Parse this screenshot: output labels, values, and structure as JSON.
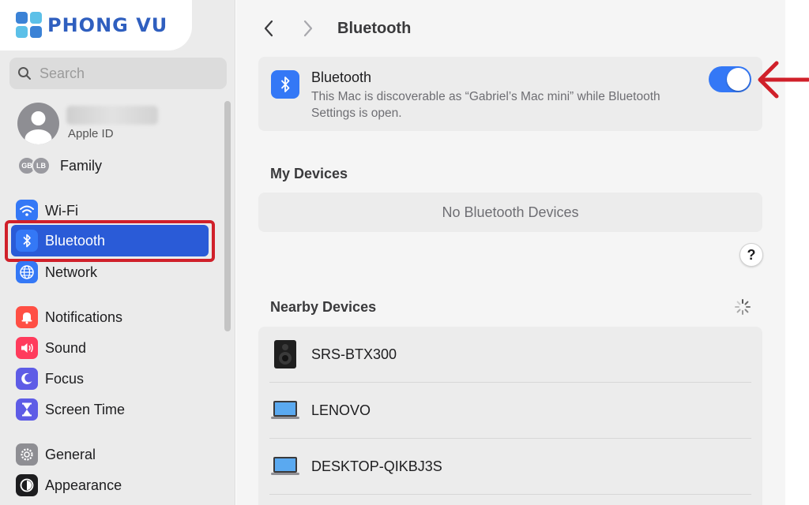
{
  "brand": {
    "name": "PHONG VU"
  },
  "sidebar": {
    "search_placeholder": "Search",
    "apple_id_label": "Apple ID",
    "family": {
      "label": "Family",
      "avatars": [
        "GB",
        "LB"
      ]
    },
    "items": [
      {
        "label": "Wi-Fi",
        "icon": "wifi-icon",
        "color": "#3478f6"
      },
      {
        "label": "Bluetooth",
        "icon": "bluetooth-icon",
        "color": "#3478f6",
        "selected": true
      },
      {
        "label": "Network",
        "icon": "globe-icon",
        "color": "#3478f6"
      },
      {
        "label": "Notifications",
        "icon": "bell-icon",
        "color": "#ff4f44"
      },
      {
        "label": "Sound",
        "icon": "speaker-icon",
        "color": "#ff3b5c"
      },
      {
        "label": "Focus",
        "icon": "moon-icon",
        "color": "#5e5ce6"
      },
      {
        "label": "Screen Time",
        "icon": "hourglass-icon",
        "color": "#5e5ce6"
      },
      {
        "label": "General",
        "icon": "gear-icon",
        "color": "#8e8e93"
      },
      {
        "label": "Appearance",
        "icon": "appearance-icon",
        "color": "#1d1d1f"
      }
    ]
  },
  "main": {
    "title": "Bluetooth",
    "bluetooth": {
      "title": "Bluetooth",
      "description": "This Mac is discoverable as “Gabriel’s Mac mini” while Bluetooth Settings is open.",
      "enabled": true
    },
    "my_devices": {
      "title": "My Devices",
      "empty_text": "No Bluetooth Devices"
    },
    "help_label": "?",
    "nearby": {
      "title": "Nearby Devices",
      "devices": [
        {
          "name": "SRS-BTX300",
          "icon": "speaker-device-icon"
        },
        {
          "name": "LENOVO",
          "icon": "laptop-icon"
        },
        {
          "name": "DESKTOP-QIKBJ3S",
          "icon": "laptop-icon"
        }
      ]
    }
  },
  "colors": {
    "accent": "#3478f6",
    "selection": "#2a5bd7",
    "annotation": "#d0202a"
  }
}
